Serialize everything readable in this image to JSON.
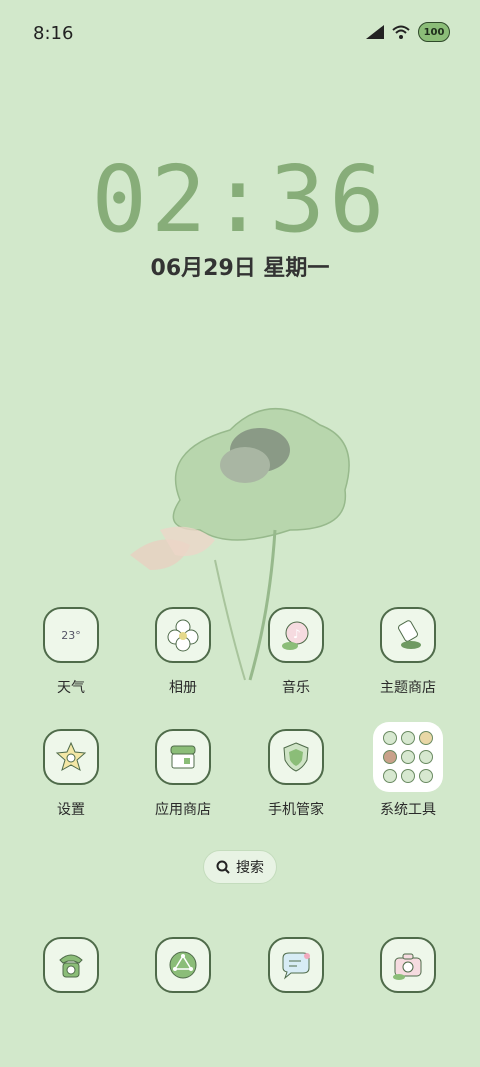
{
  "status": {
    "time": "8:16",
    "battery": "100"
  },
  "lock": {
    "clock": "02:36",
    "date": "06月29日 星期一"
  },
  "apps_row1": [
    {
      "label": "天气",
      "icon": "weather-icon",
      "icon_text": "23°"
    },
    {
      "label": "相册",
      "icon": "gallery-icon"
    },
    {
      "label": "音乐",
      "icon": "music-icon"
    },
    {
      "label": "主题商店",
      "icon": "theme-store-icon"
    }
  ],
  "apps_row2": [
    {
      "label": "设置",
      "icon": "settings-icon"
    },
    {
      "label": "应用商店",
      "icon": "app-store-icon"
    },
    {
      "label": "手机管家",
      "icon": "phone-manager-icon"
    },
    {
      "label": "系统工具",
      "icon": "system-tools-folder-icon"
    }
  ],
  "search": {
    "label": "搜索"
  },
  "dock": [
    {
      "icon": "phone-icon"
    },
    {
      "icon": "browser-icon"
    },
    {
      "icon": "messages-icon"
    },
    {
      "icon": "camera-icon"
    }
  ]
}
